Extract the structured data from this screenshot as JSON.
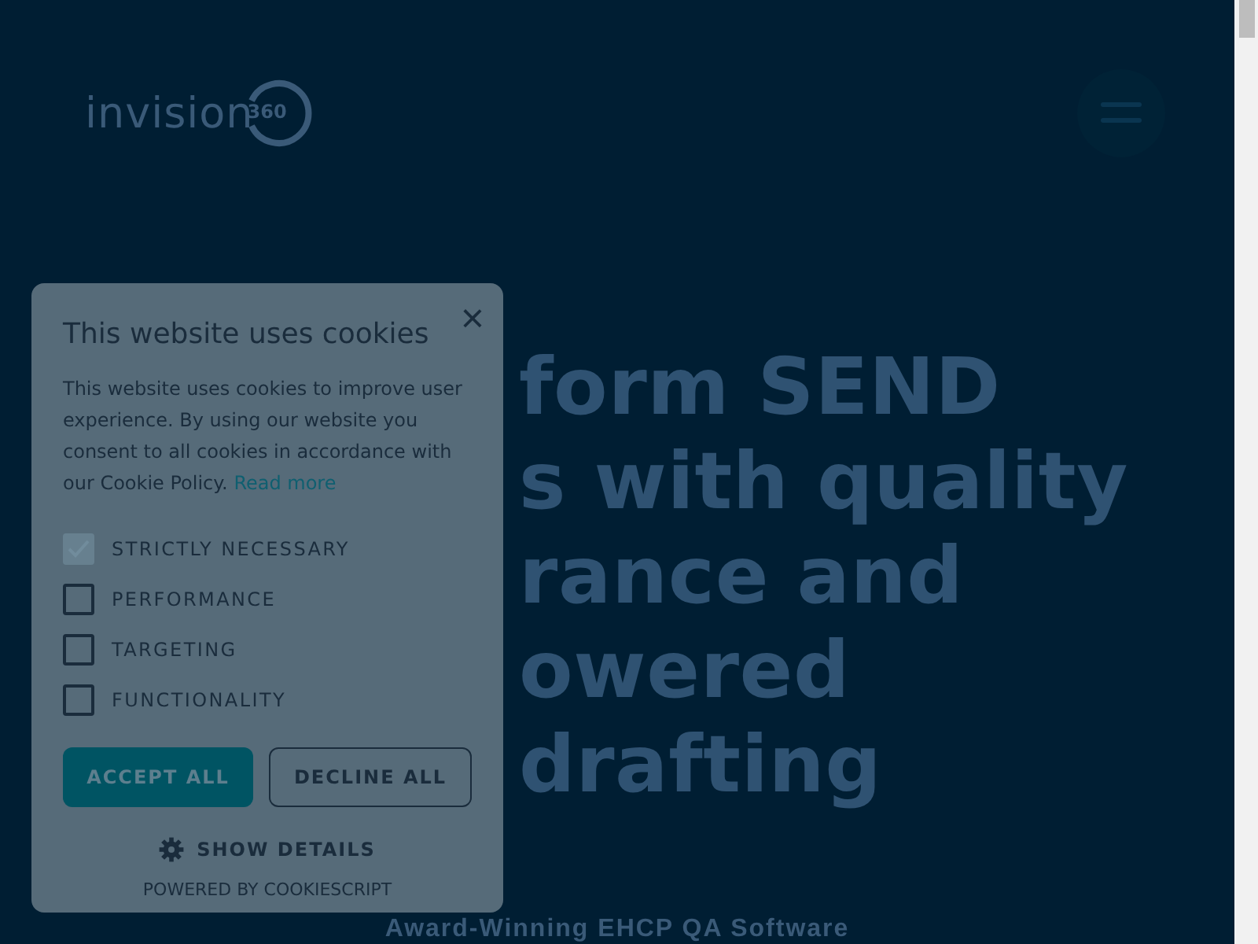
{
  "header": {
    "logo": {
      "word": "invision",
      "number": "360"
    }
  },
  "hero": {
    "heading": [
      "form SEND",
      "s with quality",
      "rance and",
      "owered",
      "drafting"
    ],
    "subtitle": "Award-Winning EHCP QA Software"
  },
  "cookie_dialog": {
    "title": "This website uses cookies",
    "body": "This website uses cookies to improve user experience. By using our website you consent to all cookies in accordance with our Cookie Policy.",
    "link": "Read more",
    "options": [
      {
        "label": "STRICTLY NECESSARY",
        "checked": true,
        "disabled": true
      },
      {
        "label": "PERFORMANCE",
        "checked": false,
        "disabled": false
      },
      {
        "label": "TARGETING",
        "checked": false,
        "disabled": false
      },
      {
        "label": "FUNCTIONALITY",
        "checked": false,
        "disabled": false
      }
    ],
    "buttons": [
      {
        "label": "ACCEPT ALL",
        "kind": "primary"
      },
      {
        "label": "DECLINE ALL",
        "kind": "outline"
      }
    ],
    "show_details": "SHOW DETAILS",
    "powered_by": "POWERED BY COOKIESCRIPT",
    "close": "×"
  }
}
